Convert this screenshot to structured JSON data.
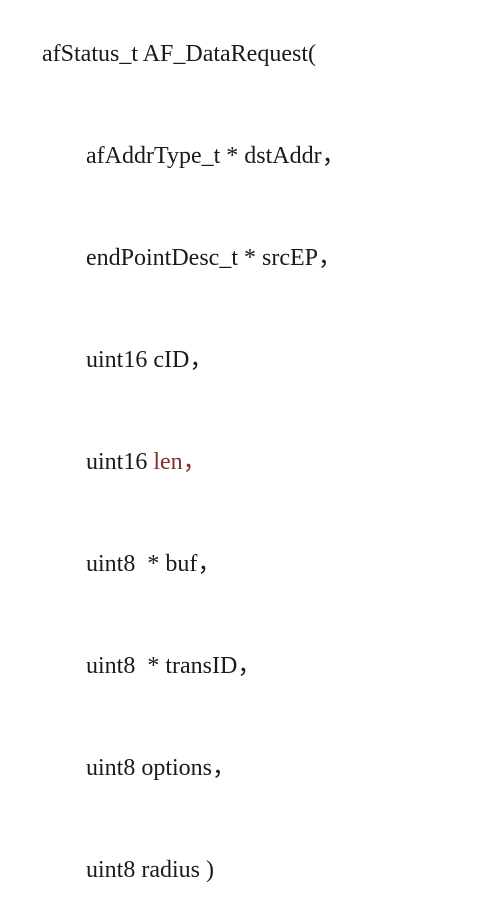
{
  "code": {
    "decl_type": "afStatus_t",
    "decl_name": "AF_DataRequest(",
    "params": [
      {
        "type": "afAddrType_t",
        "ptr": "*",
        "name": "dstAddr",
        "tail": "，"
      },
      {
        "type": "endPointDesc_t",
        "ptr": "*",
        "name": "srcEP",
        "tail": "，"
      },
      {
        "type": "uint16",
        "ptr": "",
        "name": "cID",
        "tail": "，"
      },
      {
        "type": "uint16",
        "ptr": "",
        "name": "len",
        "tail": "，",
        "highlight": true
      },
      {
        "type": "uint8",
        "ptr": " *",
        "name": "buf",
        "tail": "，"
      },
      {
        "type": "uint8",
        "ptr": " *",
        "name": "transID",
        "tail": "，"
      },
      {
        "type": "uint8",
        "ptr": "",
        "name": "options",
        "tail": "，"
      },
      {
        "type": "uint8",
        "ptr": "",
        "name": "radius",
        "tail": " )"
      }
    ]
  }
}
